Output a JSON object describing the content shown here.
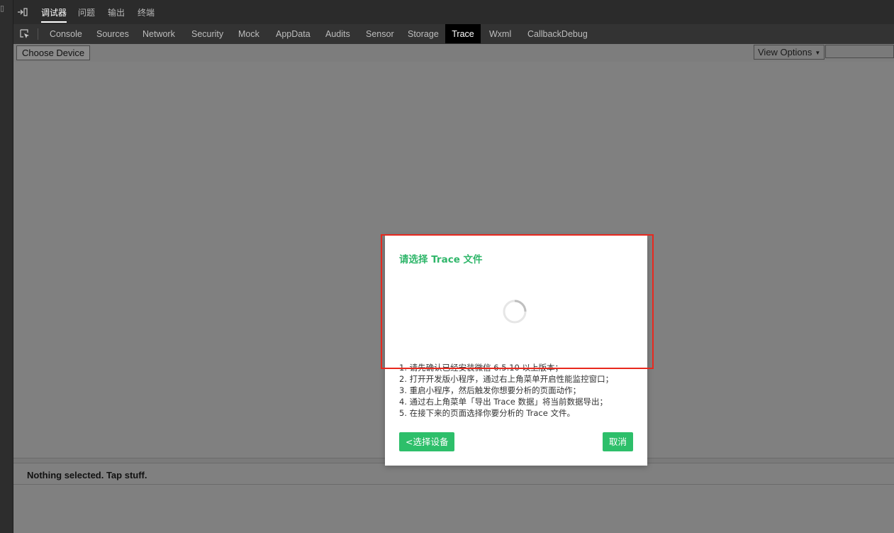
{
  "top_tabs": [
    {
      "label": "调试器",
      "active": true
    },
    {
      "label": "问题",
      "active": false
    },
    {
      "label": "输出",
      "active": false
    },
    {
      "label": "终端",
      "active": false
    }
  ],
  "panel_tabs": [
    {
      "label": "Console",
      "active": false
    },
    {
      "label": "Sources",
      "active": false
    },
    {
      "label": "Network",
      "active": false
    },
    {
      "label": "Security",
      "active": false
    },
    {
      "label": "Mock",
      "active": false
    },
    {
      "label": "AppData",
      "active": false
    },
    {
      "label": "Audits",
      "active": false
    },
    {
      "label": "Sensor",
      "active": false
    },
    {
      "label": "Storage",
      "active": false
    },
    {
      "label": "Trace",
      "active": true
    },
    {
      "label": "Wxml",
      "active": false
    },
    {
      "label": "CallbackDebug",
      "active": false
    }
  ],
  "toolbar": {
    "choose_device": "Choose Device",
    "view_options": "View Options"
  },
  "details": {
    "empty_text": "Nothing selected. Tap stuff."
  },
  "dialog": {
    "title": "请选择 Trace 文件",
    "instructions": [
      "1. 请先确认已经安装微信 6.5.10 以上版本；",
      "2. 打开开发版小程序，通过右上角菜单开启性能监控窗口；",
      "3. 重启小程序，然后触发你想要分析的页面动作；",
      "4. 通过右上角菜单「导出 Trace 数据」将当前数据导出；",
      "5. 在接下来的页面选择你要分析的 Trace 文件。"
    ],
    "back_button": "<选择设备",
    "cancel_button": "取消"
  },
  "colors": {
    "accent_green": "#2dbf6a",
    "highlight_red": "#e8281e",
    "active_tab_bg": "#000000"
  },
  "icons": {
    "dock": "dock-side-icon",
    "inspect": "inspect-element-icon",
    "spinner": "loading-spinner-icon"
  }
}
